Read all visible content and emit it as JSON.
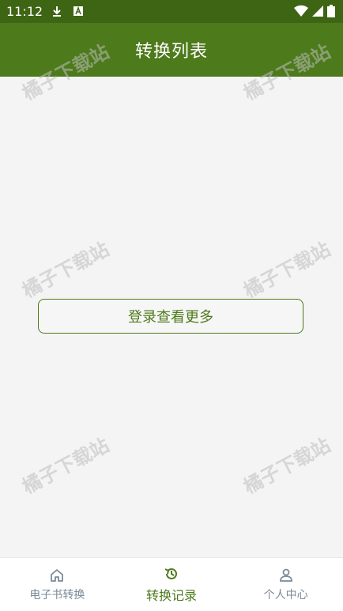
{
  "status_bar": {
    "time": "11:12"
  },
  "app_bar": {
    "title": "转换列表"
  },
  "main": {
    "login_button": "登录查看更多"
  },
  "watermark": {
    "text": "橘子下载站"
  },
  "tabs": [
    {
      "label": "电子书转换",
      "icon": "home-icon",
      "active": false
    },
    {
      "label": "转换记录",
      "icon": "history-icon",
      "active": true
    },
    {
      "label": "个人中心",
      "icon": "person-icon",
      "active": false
    }
  ],
  "colors": {
    "status_bar": "#3e6514",
    "primary": "#4d7a1b",
    "tab_inactive": "#7a8a99",
    "background": "#f4f4f4"
  }
}
